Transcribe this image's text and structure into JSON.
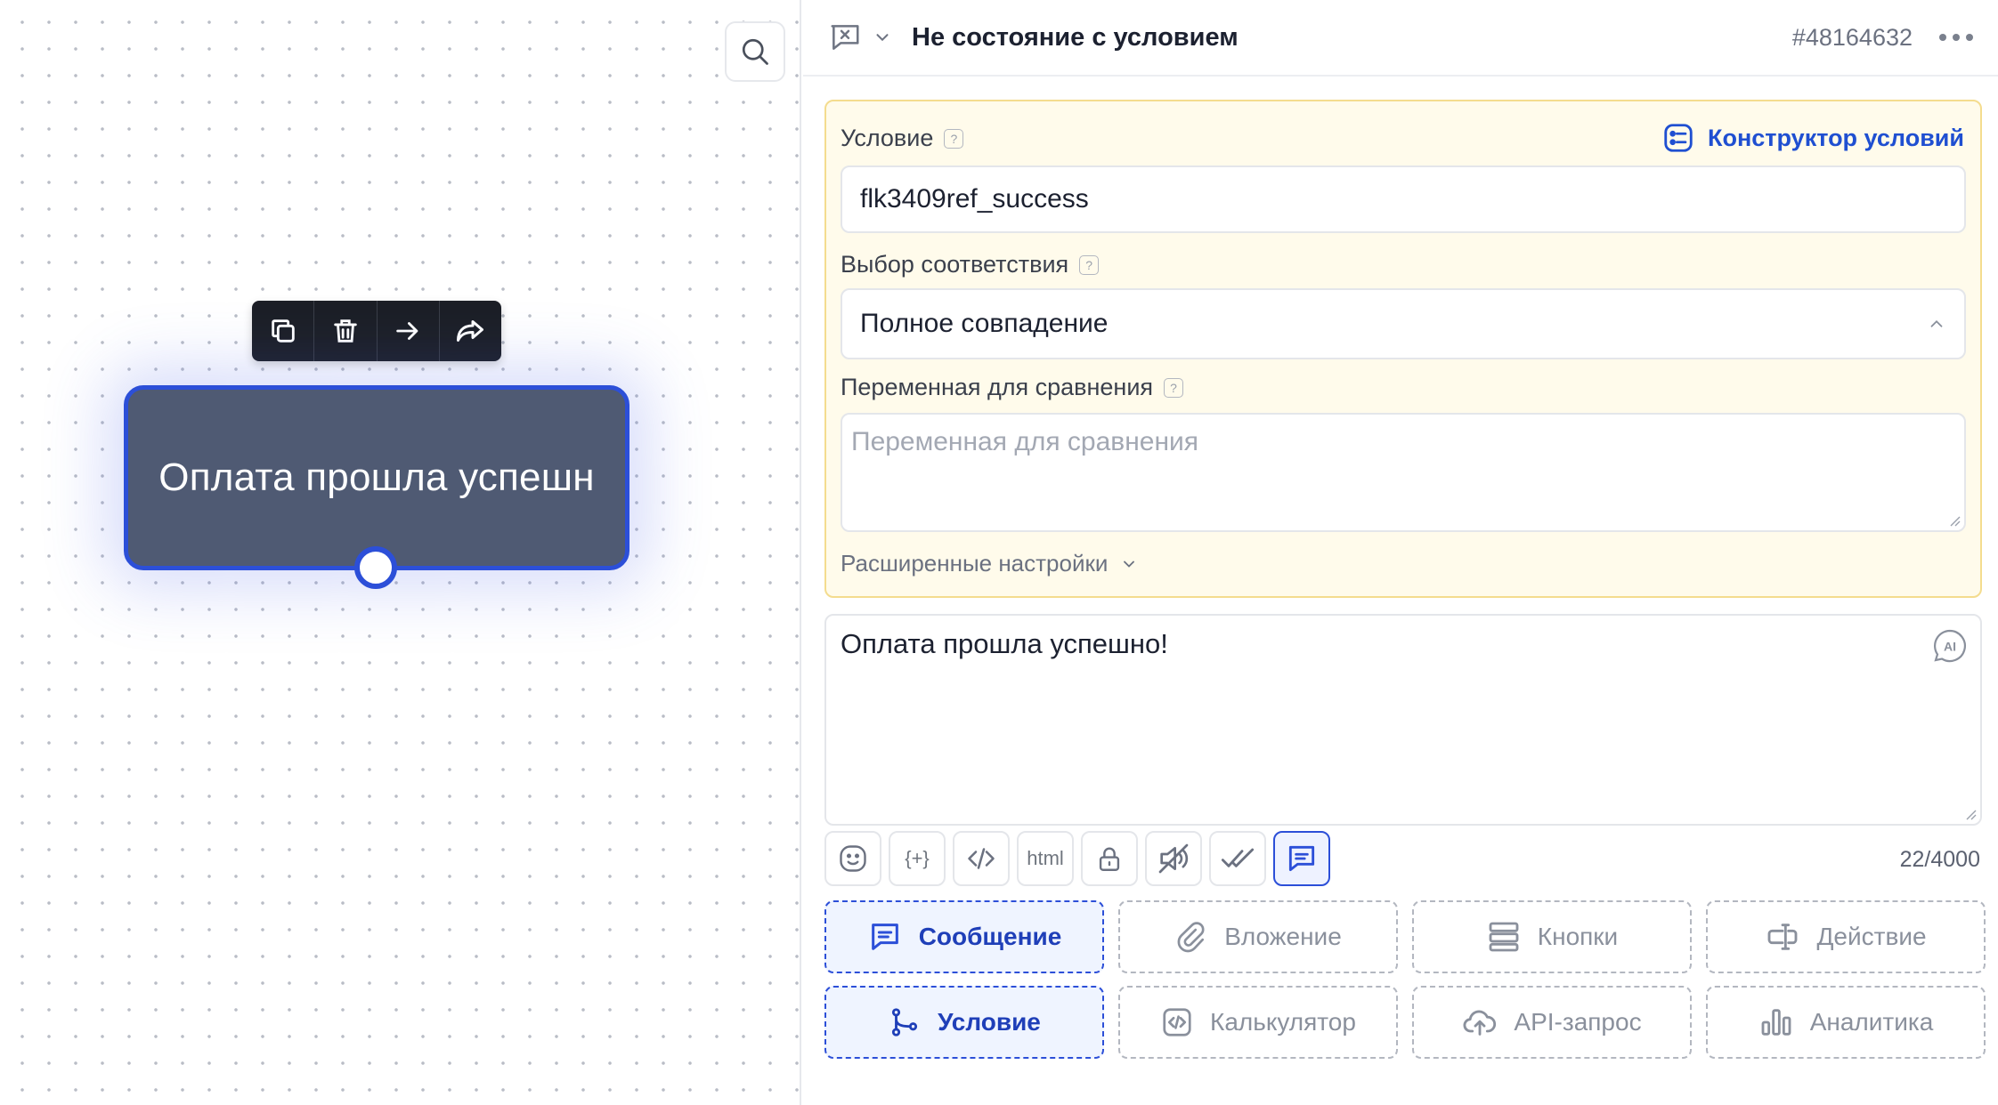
{
  "canvas": {
    "node": {
      "text": "Оплата прошла успешн"
    }
  },
  "panel": {
    "header": {
      "title": "Не состояние с условием",
      "id": "#48164632"
    },
    "condition": {
      "label": "Условие",
      "help": "?",
      "constructor_label": "Конструктор условий",
      "value": "flk3409ref_success"
    },
    "match": {
      "label": "Выбор соответствия",
      "help": "?",
      "selected": "Полное совпадение"
    },
    "compare": {
      "label": "Переменная для сравнения",
      "help": "?",
      "placeholder": "Переменная для сравнения"
    },
    "advanced_label": "Расширенные настройки",
    "message": {
      "text": "Оплата прошла успешно!",
      "ai_label": "AI",
      "counter": "22/4000"
    },
    "tools": {
      "variable_label": "{+}",
      "html_label": "html"
    },
    "blocks": [
      {
        "label": "Сообщение",
        "icon": "message-icon",
        "active": true
      },
      {
        "label": "Вложение",
        "icon": "attachment-icon",
        "active": false
      },
      {
        "label": "Кнопки",
        "icon": "buttons-icon",
        "active": false
      },
      {
        "label": "Действие",
        "icon": "action-icon",
        "active": false
      },
      {
        "label": "Условие",
        "icon": "branch-icon",
        "active": true
      },
      {
        "label": "Калькулятор",
        "icon": "code-icon",
        "active": false
      },
      {
        "label": "API-запрос",
        "icon": "cloud-upload-icon",
        "active": false
      },
      {
        "label": "Аналитика",
        "icon": "chart-icon",
        "active": false
      }
    ]
  },
  "colors": {
    "accent": "#2c4fd8",
    "node_bg": "#4f5a73",
    "condition_bg": "#fffbeb",
    "condition_border": "#f4dc8e"
  }
}
